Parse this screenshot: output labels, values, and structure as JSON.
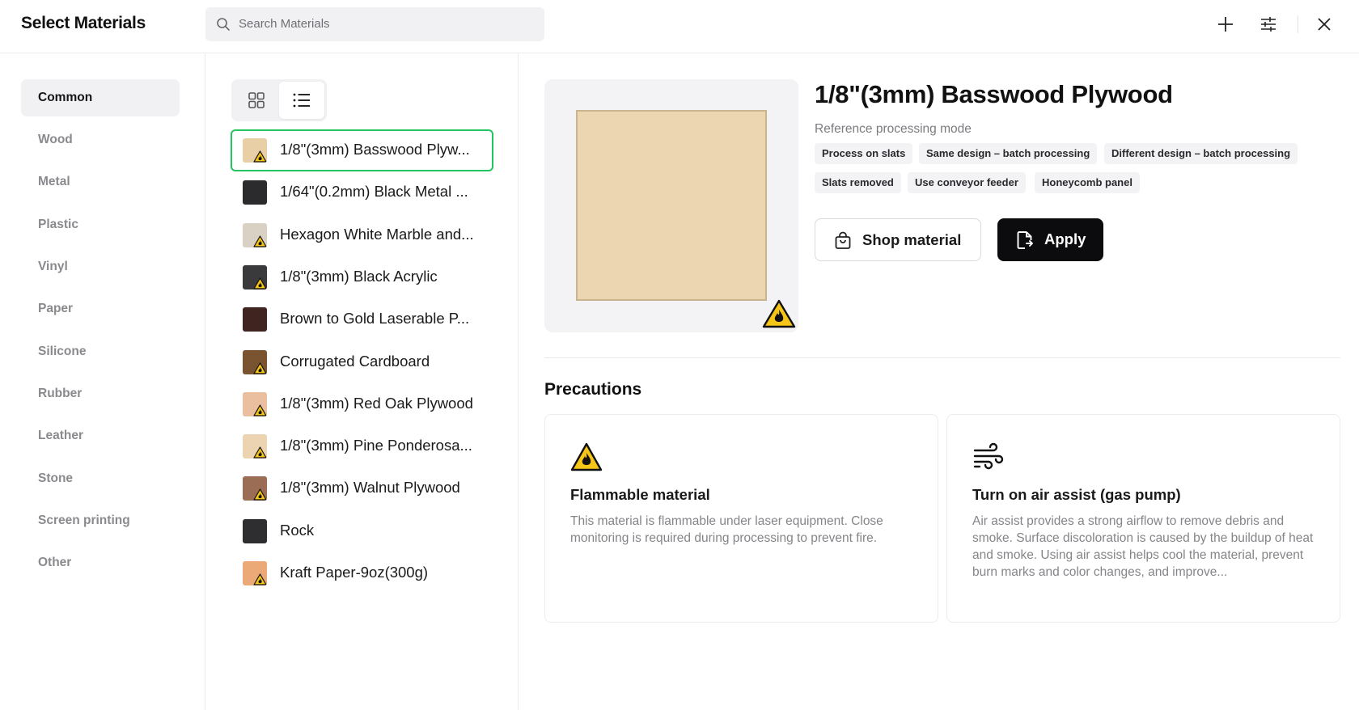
{
  "header": {
    "title": "Select Materials",
    "search_placeholder": "Search Materials"
  },
  "categories": [
    {
      "label": "Common",
      "active": true
    },
    {
      "label": "Wood"
    },
    {
      "label": "Metal"
    },
    {
      "label": "Plastic"
    },
    {
      "label": "Vinyl"
    },
    {
      "label": "Paper"
    },
    {
      "label": "Silicone"
    },
    {
      "label": "Rubber"
    },
    {
      "label": "Leather"
    },
    {
      "label": "Stone"
    },
    {
      "label": "Screen printing"
    },
    {
      "label": "Other"
    }
  ],
  "view_toggle": {
    "active": "list-view"
  },
  "materials": [
    {
      "name": "1/8\"(3mm) Basswood Plyw...",
      "swatch": "#e8cfa6",
      "flammable": true,
      "selected": true
    },
    {
      "name": "1/64\"(0.2mm) Black Metal ...",
      "swatch": "#2b2b2d",
      "flammable": false
    },
    {
      "name": "Hexagon White Marble and...",
      "swatch": "#d9d2c4",
      "flammable": true
    },
    {
      "name": "1/8\"(3mm) Black Acrylic",
      "swatch": "#3a3a3c",
      "flammable": true
    },
    {
      "name": "Brown to Gold Laserable P...",
      "swatch": "#3f2420",
      "flammable": false
    },
    {
      "name": "Corrugated Cardboard",
      "swatch": "#7a5430",
      "flammable": true
    },
    {
      "name": "1/8\"(3mm) Red Oak Plywood",
      "swatch": "#e9bfa0",
      "flammable": true
    },
    {
      "name": "1/8\"(3mm) Pine Ponderosa...",
      "swatch": "#ecd3b2",
      "flammable": true
    },
    {
      "name": "1/8\"(3mm) Walnut Plywood",
      "swatch": "#9c6d55",
      "flammable": true
    },
    {
      "name": "Rock",
      "swatch": "#2e2e30",
      "flammable": false
    },
    {
      "name": "Kraft Paper-9oz(300g)",
      "swatch": "#eba978",
      "flammable": true
    }
  ],
  "detail": {
    "title": "1/8\"(3mm) Basswood Plywood",
    "subtitle": "Reference processing mode",
    "tags": [
      "Process on slats",
      "Same design – batch processing",
      "Different design – batch processing",
      "Slats removed",
      "Use conveyor feeder",
      "Honeycomb panel"
    ],
    "shop_label": "Shop material",
    "apply_label": "Apply",
    "swatch_color": "#ecd6b1"
  },
  "precautions": {
    "title": "Precautions",
    "cards": [
      {
        "icon": "flammable-warning-icon",
        "title": "Flammable material",
        "desc": "This material is flammable under laser equipment. Close monitoring is required during processing to prevent fire."
      },
      {
        "icon": "air-assist-icon",
        "title": "Turn on air assist (gas pump)",
        "desc": "Air assist provides a strong airflow to remove debris and smoke. Surface discoloration is caused by the buildup of heat and smoke. Using air assist helps cool the material, prevent burn marks and color changes, and improve..."
      }
    ]
  },
  "colors": {
    "accent_selected": "#22c55e",
    "warning_yellow": "#f5c518",
    "primary_dark": "#0c0c0e"
  }
}
